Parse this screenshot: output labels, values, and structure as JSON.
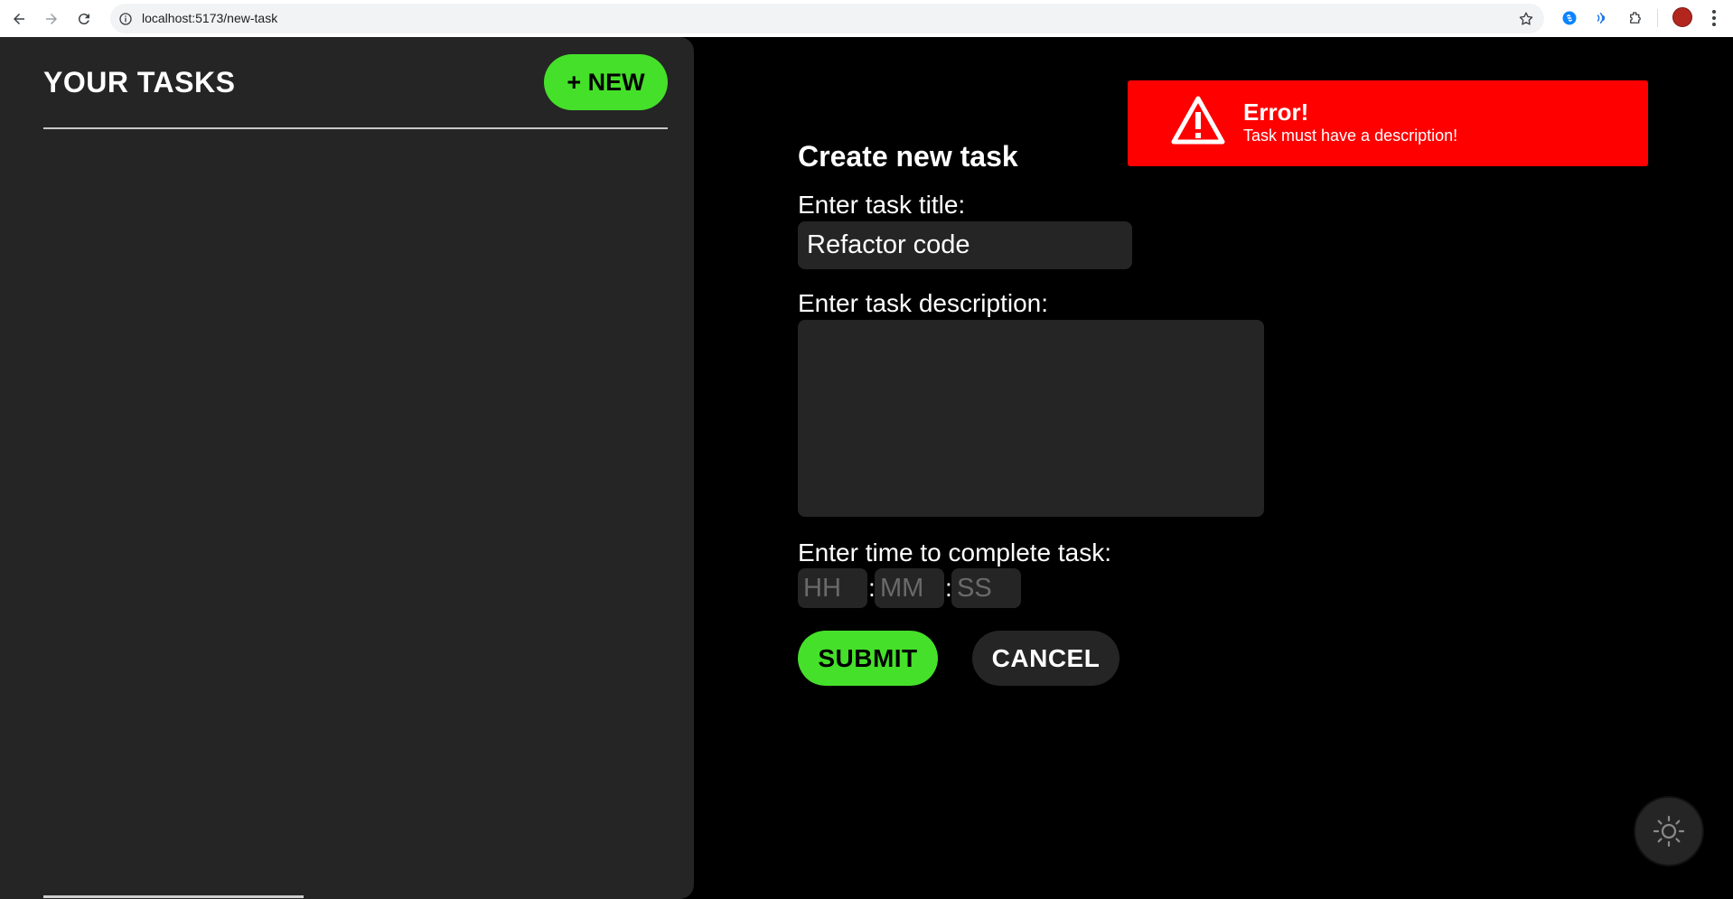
{
  "browser": {
    "url": "localhost:5173/new-task",
    "back_icon": "arrow-left-icon",
    "forward_icon": "arrow-right-icon",
    "reload_icon": "reload-icon",
    "info_icon": "info-icon",
    "bookmark_icon": "star-icon",
    "extensions": [
      "shazam-extension-icon",
      "read-aloud-extension-icon",
      "puzzle-extensions-icon"
    ],
    "profile_icon": "profile-avatar",
    "menu_icon": "kebab-menu-icon"
  },
  "sidebar": {
    "title": "YOUR TASKS",
    "new_button_label": "+ NEW",
    "tasks": []
  },
  "toast": {
    "title": "Error!",
    "message": "Task must have a description!",
    "icon": "warning-triangle-icon",
    "background_color": "#ff0000"
  },
  "form": {
    "heading": "Create new task",
    "title_label": "Enter task title:",
    "title_value": "Refactor code",
    "description_label": "Enter task description:",
    "description_value": "",
    "time_label": "Enter time to complete task:",
    "hours_placeholder": "HH",
    "minutes_placeholder": "MM",
    "seconds_placeholder": "SS",
    "time_separator": ":",
    "submit_label": "SUBMIT",
    "cancel_label": "CANCEL"
  },
  "theme_toggle": {
    "icon": "sun-icon"
  },
  "colors": {
    "accent": "#45e02a",
    "panel": "#252525",
    "background": "#000000",
    "error": "#ff0000"
  }
}
